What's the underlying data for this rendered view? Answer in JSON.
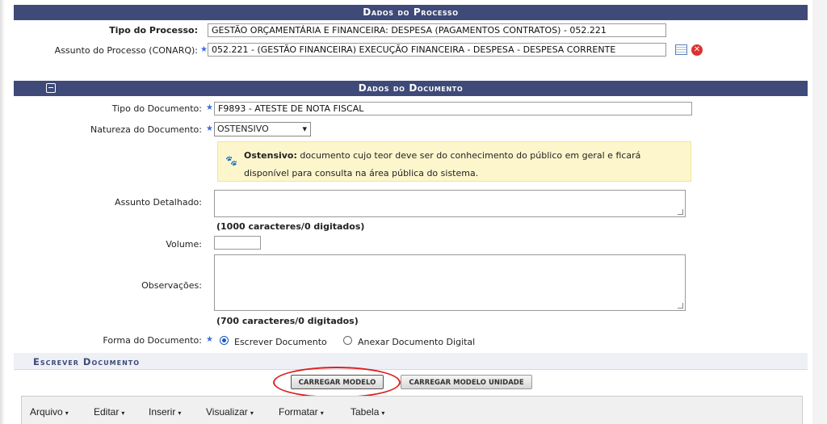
{
  "processo": {
    "header": "Dados do Processo",
    "tipo_label": "Tipo do Processo:",
    "tipo_value": "GESTÃO ORÇAMENTÁRIA E FINANCEIRA: DESPESA (PAGAMENTOS CONTRATOS) - 052.221",
    "assunto_label": "Assunto do Processo (CONARQ):",
    "assunto_value": "052.221 - (GESTÃO FINANCEIRA) EXECUÇÃO FINANCEIRA - DESPESA - DESPESA CORRENTE"
  },
  "documento": {
    "header": "Dados do Documento",
    "tipo_label": "Tipo do Documento:",
    "tipo_value": "F9893 - ATESTE DE NOTA FISCAL",
    "natureza_label": "Natureza do Documento:",
    "natureza_value": "OSTENSIVO",
    "info_bold": "Ostensivo:",
    "info_text": " documento cujo teor deve ser do conhecimento do público em geral e ficará disponível para consulta na área pública do sistema.",
    "assunto_detalhado_label": "Assunto Detalhado:",
    "assunto_counter": "(1000 caracteres/0 digitados)",
    "volume_label": "Volume:",
    "observacoes_label": "Observações:",
    "observacoes_counter": "(700 caracteres/0 digitados)",
    "forma_label": "Forma do Documento:",
    "forma_opt1": "Escrever Documento",
    "forma_opt2": "Anexar Documento Digital"
  },
  "escrever": {
    "header": "Escrever Documento",
    "btn_modelo": "CARREGAR MODELO",
    "btn_modelo_unidade": "CARREGAR MODELO UNIDADE"
  },
  "editor_menu": [
    "Arquivo",
    "Editar",
    "Inserir",
    "Visualizar",
    "Formatar",
    "Tabela"
  ],
  "required_marker": "★",
  "caret": "▾",
  "colors": {
    "header_bg": "#3f4a78",
    "info_bg": "#fdf6cc",
    "highlight_circle": "#d22222"
  }
}
